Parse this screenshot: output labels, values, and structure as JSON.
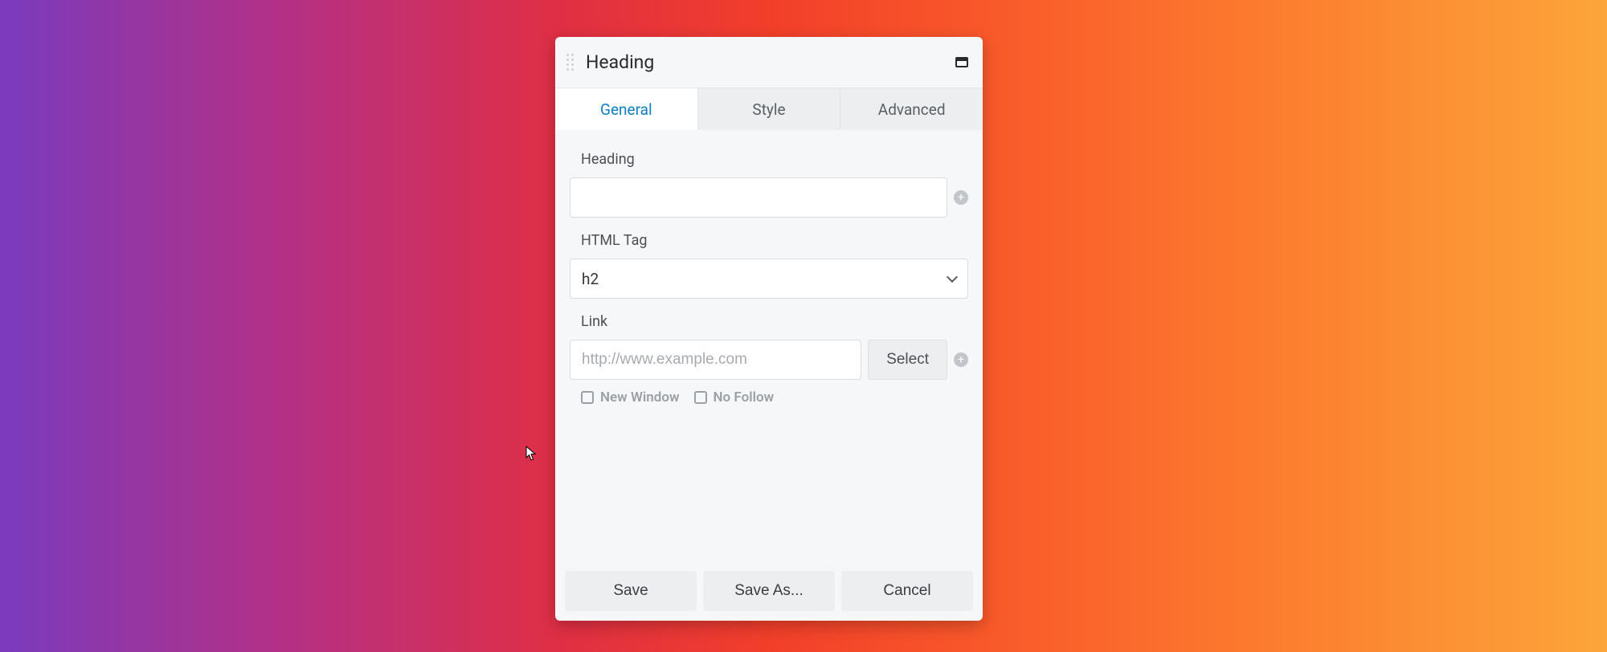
{
  "panel": {
    "title": "Heading"
  },
  "tabs": {
    "general": "General",
    "style": "Style",
    "advanced": "Advanced"
  },
  "fields": {
    "heading_label": "Heading",
    "heading_value": "",
    "htmltag_label": "HTML Tag",
    "htmltag_value": "h2",
    "link_label": "Link",
    "link_value": "",
    "link_placeholder": "http://www.example.com",
    "select_button": "Select",
    "new_window": "New Window",
    "no_follow": "No Follow"
  },
  "footer": {
    "save": "Save",
    "save_as": "Save As...",
    "cancel": "Cancel"
  }
}
